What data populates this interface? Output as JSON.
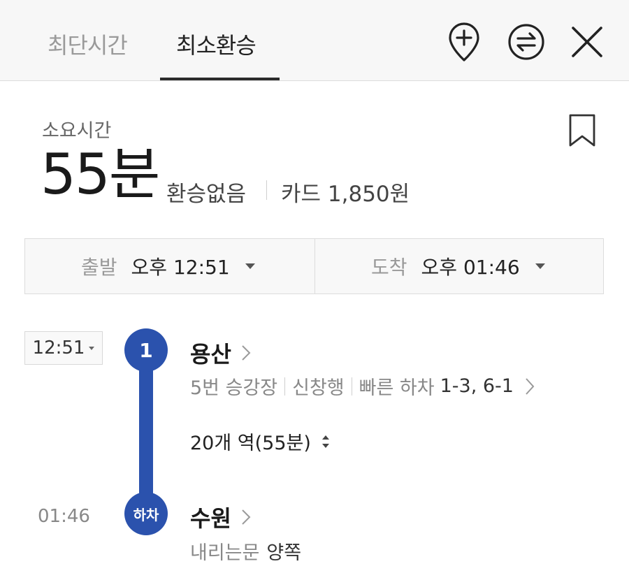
{
  "tabs": {
    "fastest": "최단시간",
    "fewest_transfers": "최소환승"
  },
  "icons": {
    "add_stop": "add-stop-pin-icon",
    "swap": "swap-icon",
    "close": "close-icon",
    "bookmark": "bookmark-icon"
  },
  "summary": {
    "duration_label": "소요시간",
    "duration": "55분",
    "transfers": "환승없음",
    "fare": "카드 1,850원"
  },
  "time_select": {
    "departure_label": "출발",
    "departure_time": "오후 12:51",
    "arrival_label": "도착",
    "arrival_time": "오후 01:46"
  },
  "route": {
    "departure_time": "12:51",
    "line_badge": "1",
    "line_color": "#2b52ad",
    "board_station": "용산",
    "platform": "5번 승강장",
    "direction": "신창행",
    "fast_exit_label": "빠른 하차",
    "fast_exit_value": "1-3, 6-1",
    "stops": "20개 역(55분)",
    "alight_badge": "하차",
    "arrival_time": "01:46",
    "alight_station": "수원",
    "doors_label": "내리는문",
    "doors_value": "양쪽"
  }
}
